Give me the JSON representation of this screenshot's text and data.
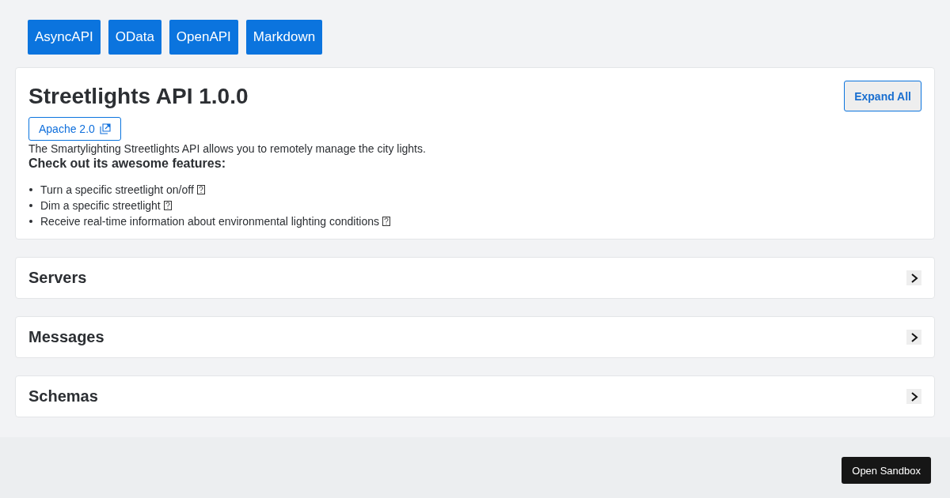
{
  "format_tabs": [
    {
      "label": "AsyncAPI"
    },
    {
      "label": "OData"
    },
    {
      "label": "OpenAPI"
    },
    {
      "label": "Markdown"
    }
  ],
  "info": {
    "title": "Streetlights API 1.0.0",
    "expand_button": "Expand All",
    "license": "Apache 2.0",
    "description": "The Smartylighting Streetlights API allows you to remotely manage the city lights.",
    "features_heading": "Check out its awesome features:",
    "features": [
      "Turn a specific streetlight on/off",
      "Dim a specific streetlight",
      "Receive real-time information about environmental lighting conditions"
    ]
  },
  "sections": [
    {
      "title": "Servers",
      "expanded": false
    },
    {
      "title": "Messages",
      "expanded": false
    },
    {
      "title": "Schemas",
      "expanded": false
    }
  ],
  "footer": {
    "button": "Open Sandbox"
  }
}
